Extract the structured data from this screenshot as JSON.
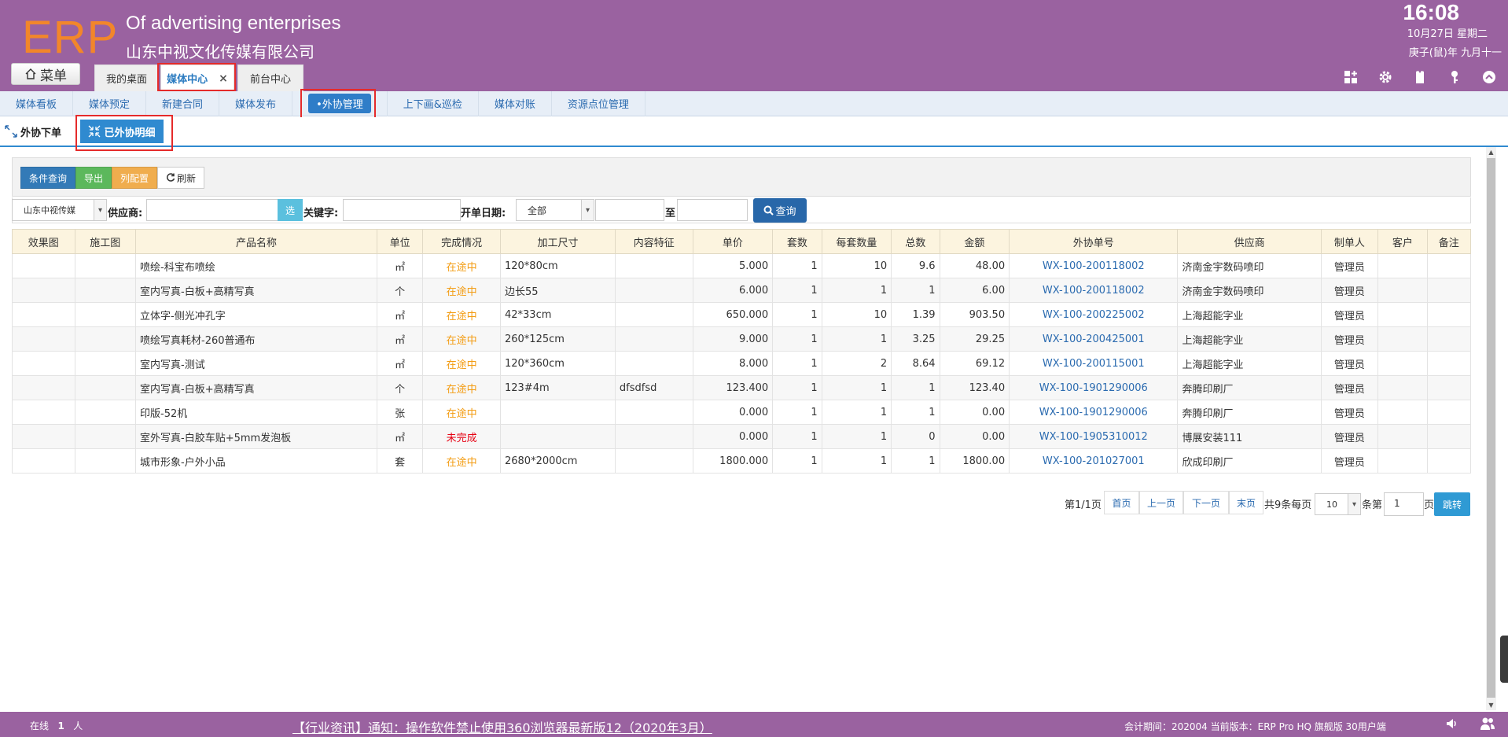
{
  "header": {
    "logo": "ERP",
    "company_en": "Of advertising enterprises",
    "company_cn": "山东中视文化传媒有限公司",
    "time": "16:08",
    "date": "10月27日 星期二",
    "lunar": "庚子(鼠)年 九月十一",
    "menu_label": "菜单",
    "tabs": [
      {
        "label": "我的桌面"
      },
      {
        "label": "媒体中心",
        "close": "×"
      },
      {
        "label": "前台中心"
      }
    ],
    "icons": [
      "grid-icon",
      "gear-icon",
      "shirt-icon",
      "key-icon",
      "up-arrow-icon"
    ]
  },
  "subnav": {
    "items": [
      "媒体看板",
      "媒体预定",
      "新建合同",
      "媒体发布",
      "•外协管理",
      "上下画&巡检",
      "媒体对账",
      "资源点位管理"
    ]
  },
  "subtabs": {
    "plain": "外协下单",
    "active": "已外协明细"
  },
  "toolbar": {
    "query": "条件查询",
    "export": "导出",
    "columns": "列配置",
    "refresh": "刷新"
  },
  "filters": {
    "company": "山东中视传媒",
    "supplier_label": "供应商:",
    "select_label": "选",
    "keyword_label": "关键字:",
    "date_label": "开单日期:",
    "date_option": "全部",
    "to_label": "至",
    "query_button": "查询"
  },
  "table": {
    "headers": [
      "效果图",
      "施工图",
      "产品名称",
      "单位",
      "完成情况",
      "加工尺寸",
      "内容特征",
      "单价",
      "套数",
      "每套数量",
      "总数",
      "金额",
      "外协单号",
      "供应商",
      "制单人",
      "客户",
      "备注"
    ],
    "rows": [
      {
        "name": "喷绘-科宝布喷绘",
        "unit": "㎡",
        "status": "在途中",
        "size": "120*80cm",
        "feature": "",
        "price": "5.000",
        "sets": "1",
        "per_set": "10",
        "total": "9.6",
        "amount": "48.00",
        "order": "WX-100-200118002",
        "supplier": "济南金宇数码喷印",
        "creator": "管理员"
      },
      {
        "name": "室内写真-白板+高精写真",
        "unit": "个",
        "status": "在途中",
        "size": "边长55",
        "feature": "",
        "price": "6.000",
        "sets": "1",
        "per_set": "1",
        "total": "1",
        "amount": "6.00",
        "order": "WX-100-200118002",
        "supplier": "济南金宇数码喷印",
        "creator": "管理员"
      },
      {
        "name": "立体字-侧光冲孔字",
        "unit": "㎡",
        "status": "在途中",
        "size": "42*33cm",
        "feature": "",
        "price": "650.000",
        "sets": "1",
        "per_set": "10",
        "total": "1.39",
        "amount": "903.50",
        "order": "WX-100-200225002",
        "supplier": "上海超能字业",
        "creator": "管理员"
      },
      {
        "name": "喷绘写真耗材-260普通布",
        "unit": "㎡",
        "status": "在途中",
        "size": "260*125cm",
        "feature": "",
        "price": "9.000",
        "sets": "1",
        "per_set": "1",
        "total": "3.25",
        "amount": "29.25",
        "order": "WX-100-200425001",
        "supplier": "上海超能字业",
        "creator": "管理员"
      },
      {
        "name": "室内写真-测试",
        "unit": "㎡",
        "status": "在途中",
        "size": "120*360cm",
        "feature": "",
        "price": "8.000",
        "sets": "1",
        "per_set": "2",
        "total": "8.64",
        "amount": "69.12",
        "order": "WX-100-200115001",
        "supplier": "上海超能字业",
        "creator": "管理员"
      },
      {
        "name": "室内写真-白板+高精写真",
        "unit": "个",
        "status": "在途中",
        "size": "123#4m",
        "feature": "dfsdfsd",
        "price": "123.400",
        "sets": "1",
        "per_set": "1",
        "total": "1",
        "amount": "123.40",
        "order": "WX-100-1901290006",
        "supplier": "奔腾印刷厂",
        "creator": "管理员"
      },
      {
        "name": "印版-52机",
        "unit": "张",
        "status": "在途中",
        "size": "",
        "feature": "",
        "price": "0.000",
        "sets": "1",
        "per_set": "1",
        "total": "1",
        "amount": "0.00",
        "order": "WX-100-1901290006",
        "supplier": "奔腾印刷厂",
        "creator": "管理员"
      },
      {
        "name": "室外写真-白胶车贴+5mm发泡板",
        "unit": "㎡",
        "status": "未完成",
        "size": "",
        "feature": "",
        "price": "0.000",
        "sets": "1",
        "per_set": "1",
        "total": "0",
        "amount": "0.00",
        "order": "WX-100-1905310012",
        "supplier": "博展安装111",
        "creator": "管理员"
      },
      {
        "name": "城市形象-户外小品",
        "unit": "套",
        "status": "在途中",
        "size": "2680*2000cm",
        "feature": "",
        "price": "1800.000",
        "sets": "1",
        "per_set": "1",
        "total": "1",
        "amount": "1800.00",
        "order": "WX-100-201027001",
        "supplier": "欣成印刷厂",
        "creator": "管理员"
      }
    ]
  },
  "pager": {
    "page_info": "第1/1页",
    "first": "首页",
    "prev": "上一页",
    "next": "下一页",
    "last": "末页",
    "total": "共9条每页",
    "page_size": "10",
    "per_label": "条第",
    "page_input": "1",
    "page_label": "页",
    "jump": "跳转"
  },
  "footer": {
    "online_label": "在线",
    "online_count": "1",
    "online_unit": "人",
    "news": "【行业资讯】通知：操作软件禁止使用360浏览器最新版12（2020年3月）",
    "period": "会计期间：202004 当前版本：ERP Pro HQ 旗舰版 30用户端"
  },
  "colors": {
    "header_bg": "#9a62a0",
    "logo": "#f2862a",
    "accent_blue": "#2f8ad0",
    "status_in_transit": "#f39c12",
    "status_incomplete": "#e60012"
  }
}
